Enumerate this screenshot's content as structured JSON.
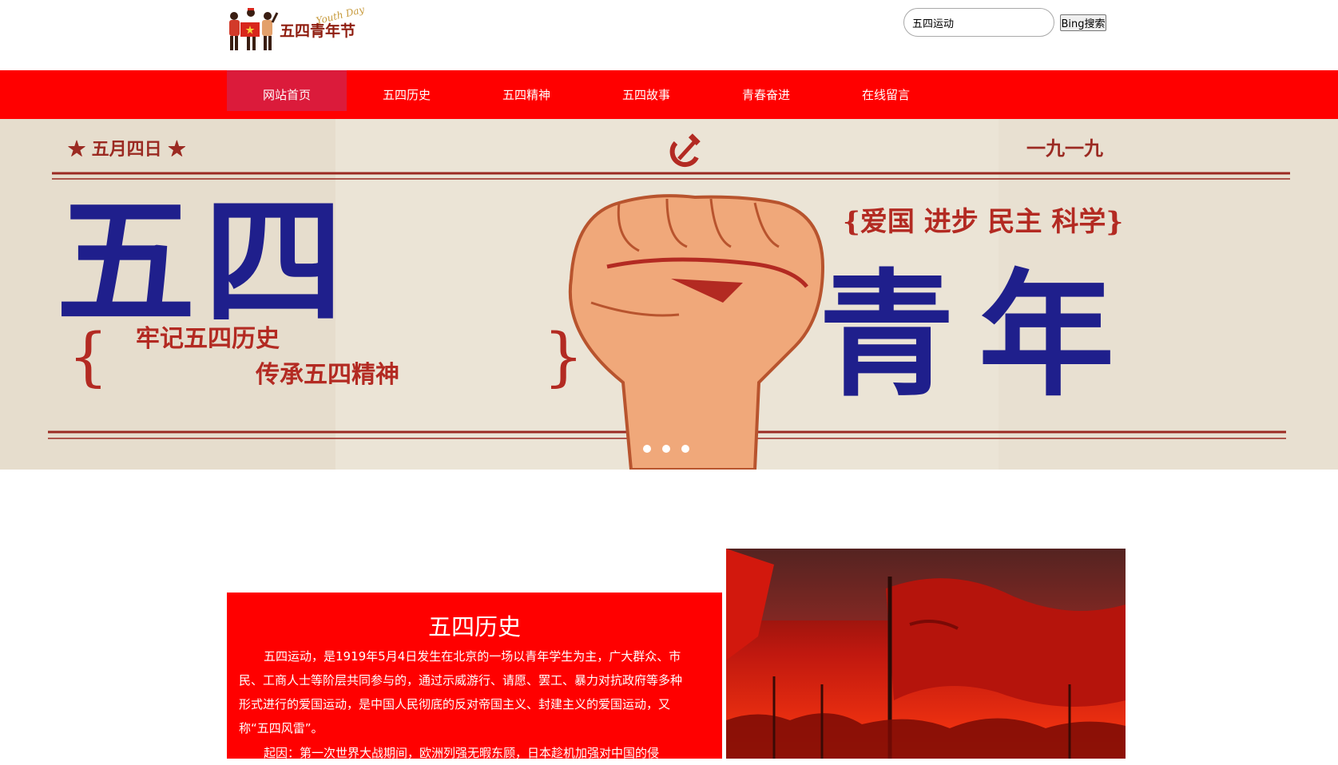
{
  "header": {
    "logo": {
      "title": "五四青年节",
      "cursive": "Youth Day"
    },
    "search": {
      "value": "五四运动",
      "button_label": "Bing搜索"
    }
  },
  "nav": {
    "items": [
      {
        "label": "网站首页",
        "active": true
      },
      {
        "label": "五四历史",
        "active": false
      },
      {
        "label": "五四精神",
        "active": false
      },
      {
        "label": "五四故事",
        "active": false
      },
      {
        "label": "青春奋进",
        "active": false
      },
      {
        "label": "在线留言",
        "active": false
      }
    ]
  },
  "banner": {
    "date_left": "★ 五月四日 ★",
    "year_right": "一九一九",
    "big_left": "五四",
    "big_right": "青年",
    "slogan": "{爱国  进步  民主  科学}",
    "line1": "牢记五四历史",
    "line2": "传承五四精神",
    "slide_count": 3,
    "active_slide": 0
  },
  "history": {
    "title": "五四历史",
    "paragraph1": "五四运动，是1919年5月4日发生在北京的一场以青年学生为主，广大群众、市民、工商人士等阶层共同参与的，通过示威游行、请愿、罢工、暴力对抗政府等多种形式进行的爱国运动，是中国人民彻底的反对帝国主义、封建主义的爱国运动，又称“五四风雷”。",
    "paragraph2": "起因：第一次世界大战期间，欧洲列强无暇东顾，日本趁机加强对中国的侵"
  },
  "colors": {
    "nav_bg": "#ff0000",
    "nav_active": "#db1b3b",
    "content_red": "#ff0000",
    "banner_blue": "#1f1f8c",
    "banner_red": "#b32a22"
  }
}
